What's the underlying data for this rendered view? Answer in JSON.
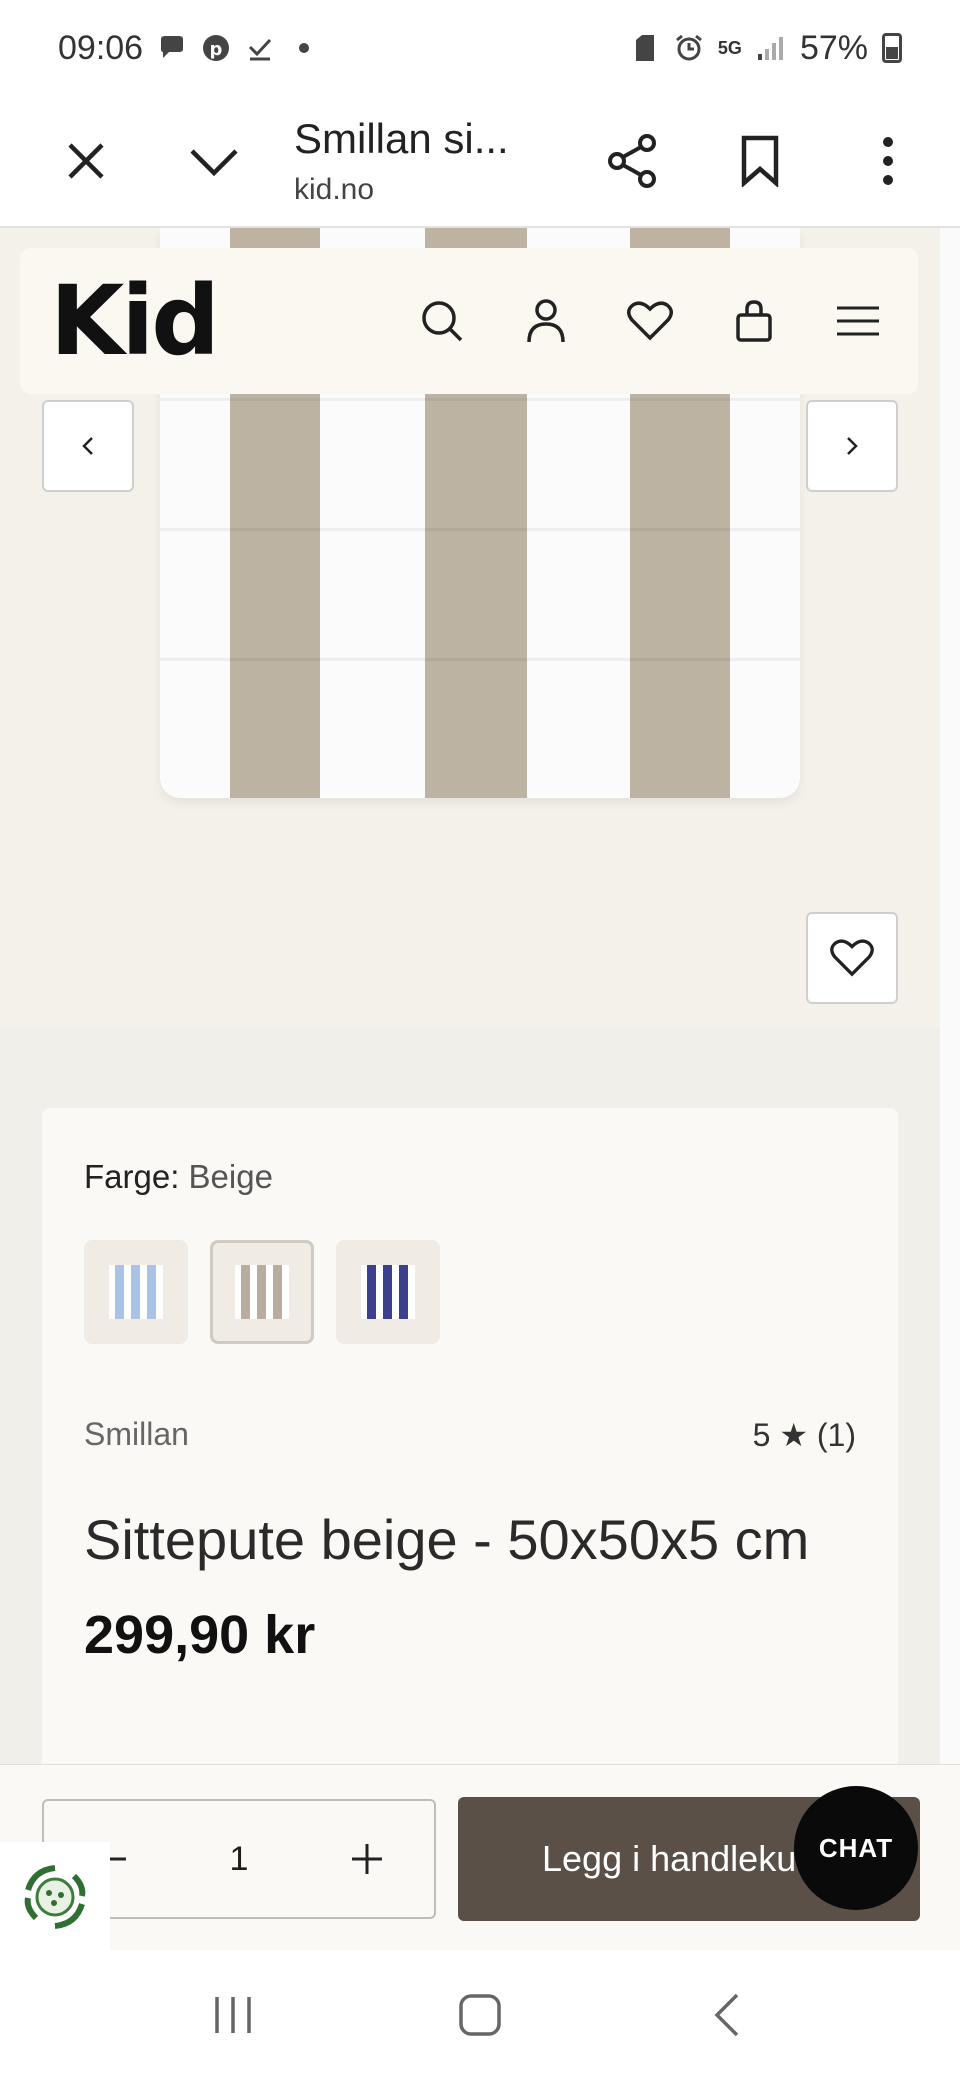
{
  "status_bar": {
    "time": "09:06",
    "network": "5G",
    "battery": "57%"
  },
  "toolbar": {
    "page_title": "Smillan si...",
    "domain": "kid.no"
  },
  "site": {
    "logo": "Kid"
  },
  "product": {
    "color_label": "Farge:",
    "color_value": "Beige",
    "swatches": [
      {
        "color": "#a9c3e6"
      },
      {
        "color": "#b8ad9c"
      },
      {
        "color": "#3b3f8c"
      }
    ],
    "brand": "Smillan",
    "rating": "5 ★ (1)",
    "title": "Sittepute beige - 50x50x5 cm",
    "price": "299,90 kr"
  },
  "buy_bar": {
    "quantity": "1",
    "add_to_cart": "Legg i handlekurv",
    "chat": "CHAT"
  },
  "colors": {
    "accent_button": "#5a5048",
    "page_bg": "#f1efea",
    "stripe_beige": "#bdb3a3"
  }
}
